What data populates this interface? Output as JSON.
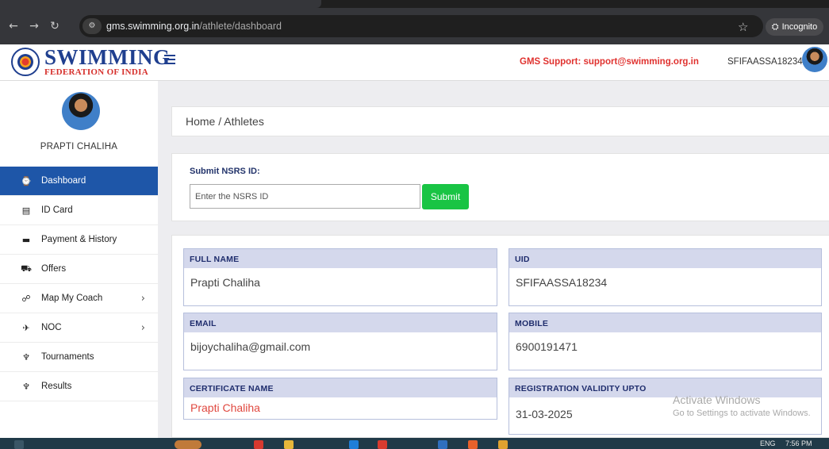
{
  "browser": {
    "url_domain": "gms.swimming.org.in",
    "url_path": "/athlete/dashboard",
    "incognito_label": "Incognito",
    "icons": [
      "back-icon",
      "forward-icon",
      "reload-icon",
      "site-info-icon",
      "star-icon",
      "incognito-icon"
    ]
  },
  "header": {
    "logo_title": "SWIMMING",
    "logo_subtitle": "FEDERATION OF INDIA",
    "support_text": "GMS Support: support@swimming.org.in",
    "user_id": "SFIFAASSA18234"
  },
  "sidebar": {
    "profile_name": "PRAPTI CHALIHA",
    "items": [
      {
        "label": "Dashboard",
        "icon": "dashboard-icon",
        "glyph": "⌚",
        "active": true,
        "chevron": false
      },
      {
        "label": "ID Card",
        "icon": "id-card-icon",
        "glyph": "▤",
        "active": false,
        "chevron": false
      },
      {
        "label": "Payment & History",
        "icon": "credit-card-icon",
        "glyph": "▬",
        "active": false,
        "chevron": false
      },
      {
        "label": "Offers",
        "icon": "cart-icon",
        "glyph": "⛟",
        "active": false,
        "chevron": false
      },
      {
        "label": "Map My Coach",
        "icon": "handshake-icon",
        "glyph": "☍",
        "active": false,
        "chevron": true
      },
      {
        "label": "NOC",
        "icon": "plane-icon",
        "glyph": "✈",
        "active": false,
        "chevron": true
      },
      {
        "label": "Tournaments",
        "icon": "trophy-icon",
        "glyph": "♆",
        "active": false,
        "chevron": false
      },
      {
        "label": "Results",
        "icon": "trophy-icon",
        "glyph": "♆",
        "active": false,
        "chevron": false
      }
    ],
    "chevron_glyph": "›"
  },
  "main": {
    "breadcrumb": "Home / Athletes",
    "nsrs": {
      "label": "Submit NSRS ID:",
      "placeholder": "Enter the NSRS ID",
      "button": "Submit"
    },
    "fields": {
      "full_name": {
        "label": "FULL NAME",
        "value": "Prapti Chaliha"
      },
      "uid": {
        "label": "UID",
        "value": "SFIFAASSA18234"
      },
      "email": {
        "label": "EMAIL",
        "value": "bijoychaliha@gmail.com"
      },
      "mobile": {
        "label": "MOBILE",
        "value": "6900191471"
      },
      "certificate_name": {
        "label": "CERTIFICATE NAME",
        "value": "Prapti Chaliha"
      },
      "registration_validity": {
        "label": "REGISTRATION VALIDITY UPTO",
        "value": "31-03-2025"
      }
    }
  },
  "watermark": {
    "line1": "Activate Windows",
    "line2": "Go to Settings to activate Windows."
  },
  "taskbar": {
    "lang": "ENG",
    "time": "7:56 PM"
  },
  "colors": {
    "brand_blue": "#1f3f8f",
    "active_menu": "#1e56a8",
    "submit_green": "#19c444",
    "support_red": "#e0322f",
    "field_header": "#d4d8ec"
  }
}
